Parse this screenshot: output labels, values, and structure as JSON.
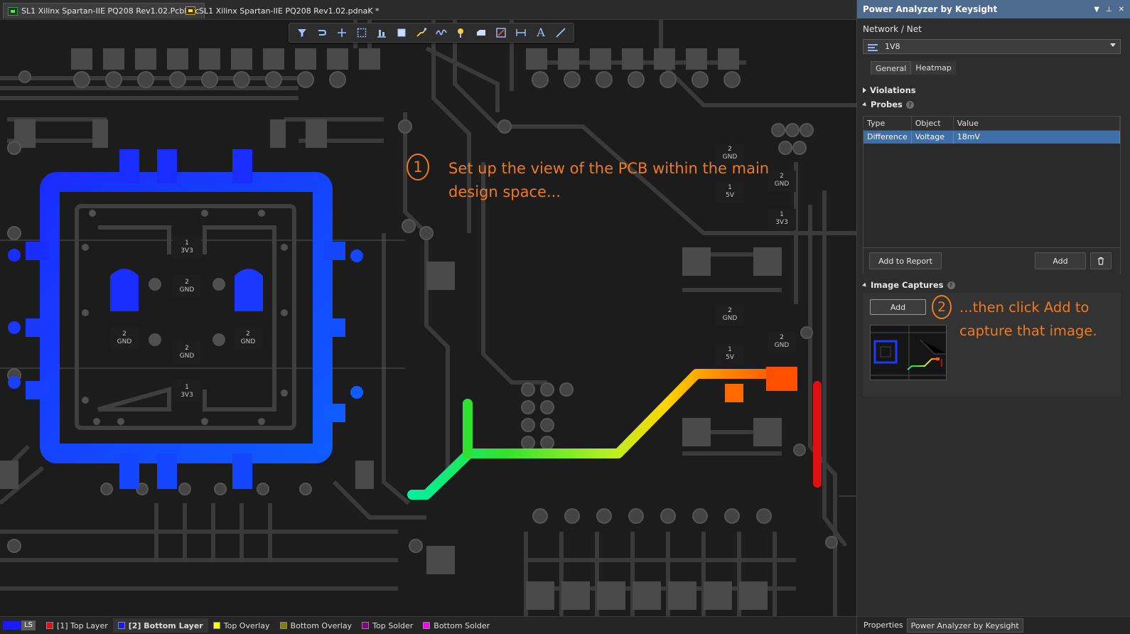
{
  "document_tabs": [
    {
      "label": "SL1 Xilinx Spartan-IIE PQ208 Rev1.02.PcbDoc",
      "active": true
    },
    {
      "label": "SL1 Xilinx Spartan-IIE PQ208 Rev1.02.pdnaK *",
      "active": false
    }
  ],
  "toolbar": {
    "buttons": [
      "filter-icon",
      "route-icon",
      "crosshair-icon",
      "select-rect-icon",
      "align-icon",
      "component-icon",
      "interactive-route-icon",
      "diff-pair-icon",
      "via-icon",
      "fill-icon",
      "region-icon",
      "dimension-icon",
      "text-icon",
      "line-icon"
    ],
    "text_button_glyph": "A"
  },
  "board_labels": {
    "chip_3v3_top": [
      "1",
      "3V3"
    ],
    "chip_gnd_center": [
      "2",
      "GND"
    ],
    "chip_gnd_left": [
      "2",
      "GND"
    ],
    "chip_gnd_right": [
      "2",
      "GND"
    ],
    "chip_gnd_lower": [
      "2",
      "GND"
    ],
    "chip_3v3_bottom": [
      "1",
      "3V3"
    ],
    "right_gnd_a": [
      "2",
      "GND"
    ],
    "right_5v_a": [
      "1",
      "5V"
    ],
    "right_gnd_b": [
      "2",
      "GND"
    ],
    "right_3v3_b": [
      "1",
      "3V3"
    ],
    "right_gnd_c": [
      "2",
      "GND"
    ],
    "right_5v_c": [
      "1",
      "5V"
    ],
    "right_gnd_d": [
      "2",
      "GND"
    ]
  },
  "callouts": {
    "step1_number": "1",
    "step1_line1": "Set up the view of the PCB within the main",
    "step1_line2": "design space...",
    "step2_number": "2",
    "step2_line1": "...then click Add to",
    "step2_line2": "capture that image."
  },
  "layer_bar": {
    "ls_label": "LS",
    "layers": [
      {
        "label": "[1] Top Layer",
        "color": "#e01010",
        "active": false
      },
      {
        "label": "[2] Bottom Layer",
        "color": "#1a1aff",
        "active": true
      },
      {
        "label": "Top Overlay",
        "color": "#ffff00",
        "active": false
      },
      {
        "label": "Bottom Overlay",
        "color": "#808000",
        "active": false
      },
      {
        "label": "Top Solder",
        "color": "#800080",
        "active": false
      },
      {
        "label": "Bottom Solder",
        "color": "#ff00ff",
        "active": false
      }
    ]
  },
  "panel": {
    "title": "Power Analyzer by Keysight",
    "network_label": "Network / Net",
    "net_value": "1V8",
    "tabs": [
      "General",
      "Heatmap"
    ],
    "active_tab": "General",
    "violations_label": "Violations",
    "probes_label": "Probes",
    "probe_columns": [
      "Type",
      "Object",
      "Value"
    ],
    "probe_rows": [
      {
        "type": "Difference",
        "object": "Voltage",
        "value": "18mV"
      }
    ],
    "add_to_report_label": "Add to Report",
    "probe_add_label": "Add",
    "image_captures_label": "Image Captures",
    "capture_add_label": "Add"
  },
  "bottom_tabs": [
    "Properties",
    "Power Analyzer by Keysight"
  ],
  "active_bottom_tab": "Power Analyzer by Keysight",
  "colors": {
    "accent_orange": "#f07a1e",
    "panel_header": "#4d6a8f",
    "selected_row": "#3f6fa8",
    "net_blue": "#1a3cff"
  }
}
